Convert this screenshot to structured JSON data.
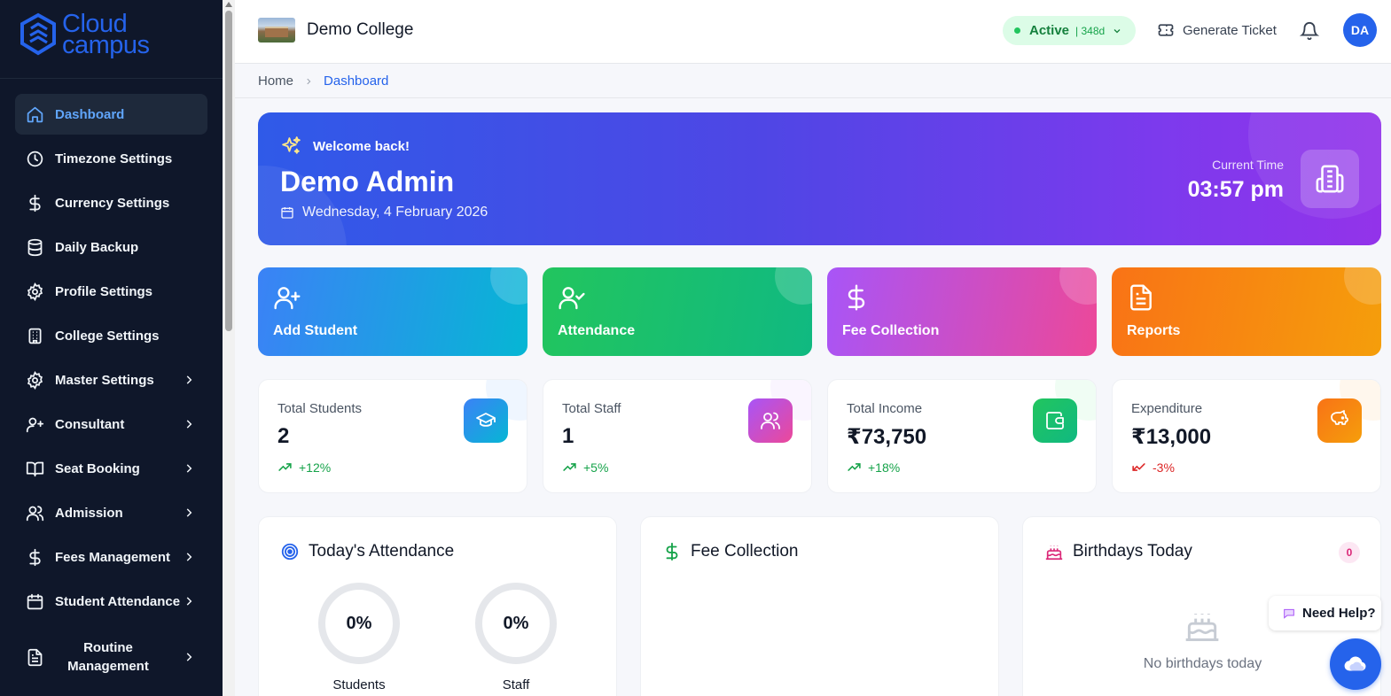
{
  "brand": {
    "line1": "Cloud",
    "line2": "campus",
    "color": "#2563eb"
  },
  "sidebar": {
    "items": [
      {
        "label": "Dashboard",
        "icon": "home-icon",
        "active": true
      },
      {
        "label": "Timezone Settings",
        "icon": "clock-icon"
      },
      {
        "label": "Currency Settings",
        "icon": "dollar-icon"
      },
      {
        "label": "Daily Backup",
        "icon": "database-icon"
      },
      {
        "label": "Profile Settings",
        "icon": "gear-icon"
      },
      {
        "label": "College Settings",
        "icon": "building-icon"
      },
      {
        "label": "Master Settings",
        "icon": "gear-icon",
        "has_submenu": true
      },
      {
        "label": "Consultant",
        "icon": "user-plus-icon",
        "has_submenu": true
      },
      {
        "label": "Seat Booking",
        "icon": "book-open-icon",
        "has_submenu": true
      },
      {
        "label": "Admission",
        "icon": "users-icon",
        "has_submenu": true
      },
      {
        "label": "Fees Management",
        "icon": "dollar-icon",
        "has_submenu": true
      },
      {
        "label": "Student Attendance",
        "icon": "calendar-icon",
        "has_submenu": true
      },
      {
        "label": "Routine Management",
        "icon": "file-text-icon",
        "has_submenu": true
      }
    ]
  },
  "header": {
    "college_name": "Demo College",
    "status": {
      "label": "Active",
      "days": "| 348d",
      "color": "#22c55e"
    },
    "generate_ticket": "Generate Ticket",
    "avatar_initials": "DA"
  },
  "breadcrumb": {
    "home": "Home",
    "current": "Dashboard"
  },
  "welcome": {
    "greeting": "Welcome back!",
    "name": "Demo Admin",
    "date": "Wednesday, 4 February 2026",
    "time_label": "Current Time",
    "time": "03:57 pm"
  },
  "quick_actions": [
    {
      "label": "Add Student",
      "icon": "user-plus-icon"
    },
    {
      "label": "Attendance",
      "icon": "user-check-icon"
    },
    {
      "label": "Fee Collection",
      "icon": "dollar-icon"
    },
    {
      "label": "Reports",
      "icon": "file-text-icon"
    }
  ],
  "stats": [
    {
      "label": "Total Students",
      "value": "2",
      "trend": "+12%",
      "trend_color": "#16a34a",
      "icon": "graduation-cap-icon"
    },
    {
      "label": "Total Staff",
      "value": "1",
      "trend": "+5%",
      "trend_color": "#16a34a",
      "icon": "users-icon"
    },
    {
      "label": "Total Income",
      "value": "₹73,750",
      "trend": "+18%",
      "trend_color": "#16a34a",
      "icon": "wallet-icon"
    },
    {
      "label": "Expenditure",
      "value": "₹13,000",
      "trend": "-3%",
      "trend_color": "#dc2626",
      "icon": "piggy-bank-icon"
    }
  ],
  "attendance": {
    "title": "Today's Attendance",
    "students": {
      "value": "0%",
      "label": "Students"
    },
    "staff": {
      "value": "0%",
      "label": "Staff"
    }
  },
  "fee_panel": {
    "title": "Fee Collection"
  },
  "birthdays": {
    "title": "Birthdays Today",
    "count": "0",
    "empty": "No birthdays today"
  },
  "help": {
    "label": "Need Help?"
  }
}
